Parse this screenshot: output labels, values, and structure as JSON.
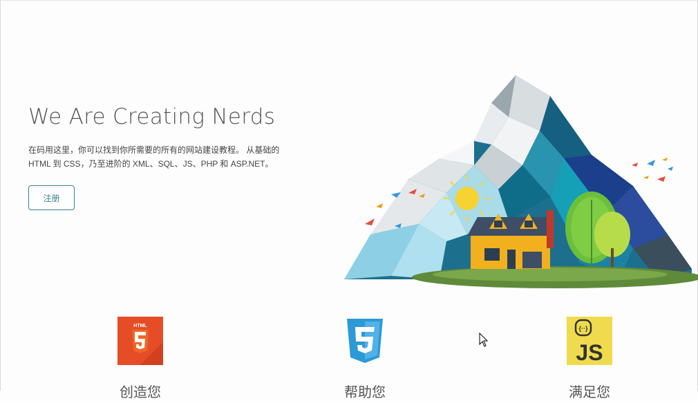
{
  "hero": {
    "title": "We Are Creating Nerds",
    "description": "在码用这里，你可以找到你所需要的所有的网站建设教程。 从基础的 HTML 到 CSS，乃至进阶的 XML、SQL、JS、PHP 和 ASP.NET。",
    "signup_label": "注册"
  },
  "features": [
    {
      "label": "创造您",
      "logo": "html5-icon",
      "logo_text": "HTML",
      "color": "#e44d26"
    },
    {
      "label": "帮助您",
      "logo": "css3-icon",
      "color": "#2b9ad6"
    },
    {
      "label": "满足您",
      "logo": "javascript-icon",
      "logo_text": "JS",
      "color": "#f0db4f"
    }
  ],
  "illustration": "mountain-house-illustration"
}
